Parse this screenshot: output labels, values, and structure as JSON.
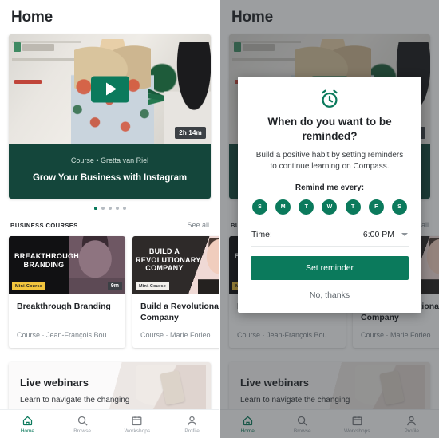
{
  "app": {
    "page_title": "Home",
    "accent_green": "#0b7a5c",
    "banner_green": "#14463b",
    "badge_yellow": "#f2c53d",
    "scrim": "rgba(40,44,48,0.46)"
  },
  "hero": {
    "play_icon": "play-icon",
    "duration": "2h 14m",
    "subtitle": "Course • Gretta  van Riel",
    "title": "Grow Your Business with Instagram",
    "dots_total": 5,
    "dots_active_index": 0
  },
  "business_section": {
    "heading": "BUSINESS COURSES",
    "see_all": "See all",
    "cards": [
      {
        "art_title": "BREAKTHROUGH\nBRANDING",
        "badge": "Mini-Course",
        "duration": "9m",
        "title": "Breakthrough Branding",
        "meta": "Course · Jean-François Boucha..."
      },
      {
        "art_title": "BUILD A\nREVOLUTIONARY\nCOMPANY",
        "badge": "Mini-Course",
        "duration": "",
        "title": "Build a Revolutionary Company",
        "meta": "Course · Marie  Forleo"
      }
    ]
  },
  "webinar": {
    "title": "Live webinars",
    "subtitle": "Learn to navigate the changing"
  },
  "bottom_nav": {
    "items": [
      {
        "label": "Home",
        "icon": "home-icon",
        "active": true
      },
      {
        "label": "Browse",
        "icon": "search-icon",
        "active": false
      },
      {
        "label": "Workshops",
        "icon": "calendar-icon",
        "active": false
      },
      {
        "label": "Profile",
        "icon": "person-icon",
        "active": false
      }
    ]
  },
  "modal": {
    "icon": "alarm-clock-icon",
    "heading": "When do you want to be reminded?",
    "body": "Build a positive habit by setting reminders to continue learning on Compass.",
    "remind_label": "Remind me every:",
    "days": [
      {
        "label": "S",
        "selected": true
      },
      {
        "label": "M",
        "selected": true
      },
      {
        "label": "T",
        "selected": true
      },
      {
        "label": "W",
        "selected": true
      },
      {
        "label": "T",
        "selected": true
      },
      {
        "label": "F",
        "selected": true
      },
      {
        "label": "S",
        "selected": true
      }
    ],
    "time_label": "Time:",
    "time_value": "6:00 PM",
    "time_caret": "chevron-down-icon",
    "primary_button": "Set reminder",
    "secondary_button": "No, thanks"
  }
}
